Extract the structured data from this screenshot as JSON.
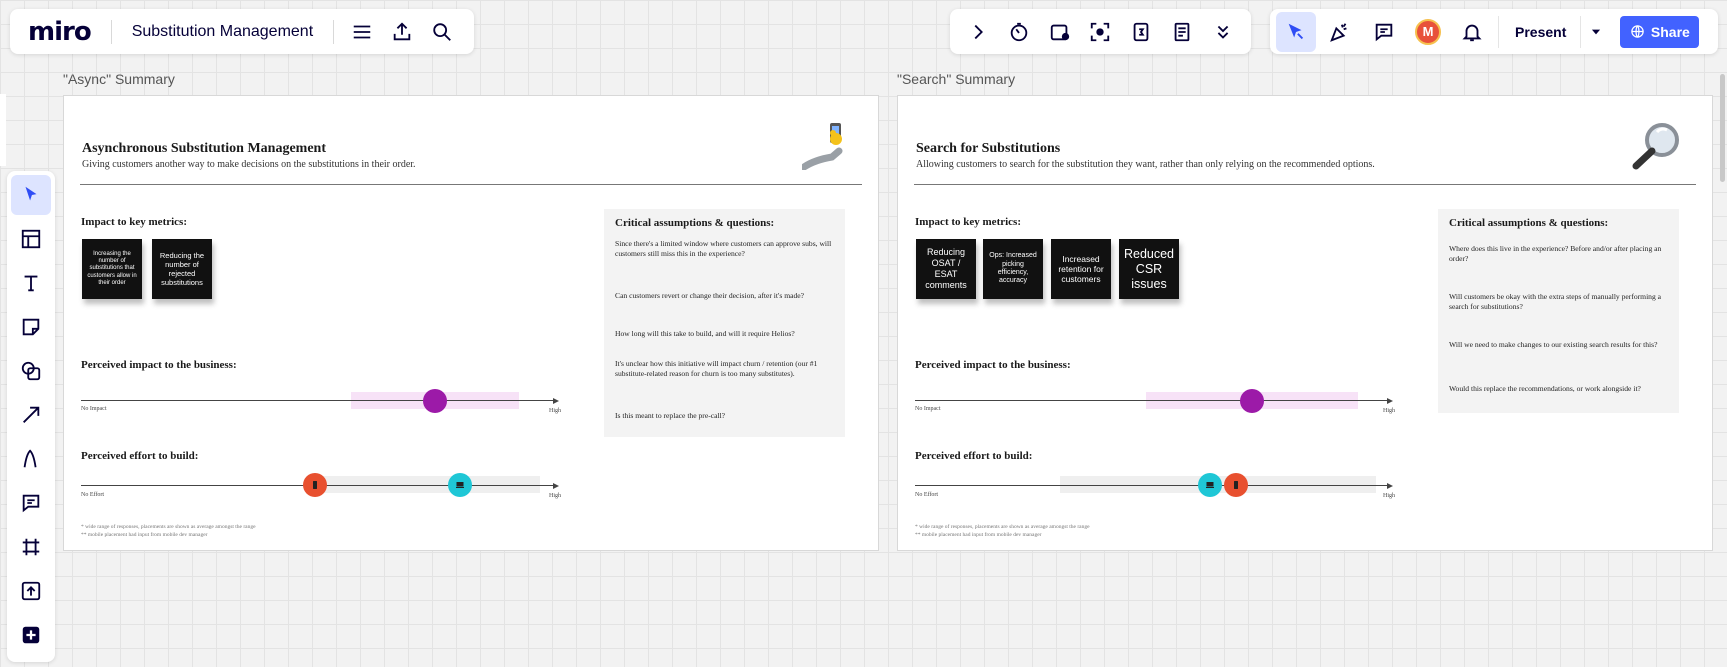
{
  "app": {
    "logo": "miro",
    "board_title": "Substitution Management",
    "present_label": "Present",
    "share_label": "Share",
    "avatar_initial": "M",
    "accent": "#4262ff"
  },
  "top_left_icons": [
    "menu-icon",
    "export-icon",
    "search-icon"
  ],
  "top_right_icons": [
    "chevron-right-icon",
    "timer-icon",
    "voting-icon",
    "focus-icon",
    "calendar-icon",
    "notes-icon",
    "more-chevron-icon"
  ],
  "collab_icons": [
    "cursor-follow-icon",
    "reactions-icon",
    "comments-icon",
    "avatar",
    "bell-icon"
  ],
  "left_toolbar": [
    "select-icon",
    "templates-icon",
    "text-icon",
    "sticky-note-icon",
    "shapes-icon",
    "arrow-icon",
    "pen-icon",
    "comment-icon",
    "frame-icon",
    "upload-icon",
    "add-icon"
  ],
  "frames": [
    {
      "label": "\"Async\" Summary",
      "title": "Asynchronous Substitution Management",
      "subtitle": "Giving customers another way to make decisions on the substitutions in their order.",
      "emoji": "phone-hand",
      "metrics_heading": "Impact to key metrics:",
      "stickies": [
        "Increasing the number of substitutions that customers allow in their order",
        "Reducing the number of rejected substitutions"
      ],
      "business_heading": "Perceived impact to the business:",
      "business_low": "No Impact",
      "business_high": "High",
      "effort_heading": "Perceived effort to build:",
      "effort_low": "No Effort",
      "effort_high": "High",
      "footnote_1": "* wide range of responses, placements are shown as average amongst the range",
      "footnote_2": "** mobile placement had input from mobile dev manager",
      "questions_heading": "Critical assumptions & questions:",
      "questions": [
        "Since there's a limited window where customers can approve subs, will customers still miss this in the experience?",
        "Can customers revert or change their decision, after it's made?",
        "How long will this take to build, and will it require Helios?",
        "It's unclear how this initiative will impact churn / retention (our #1 substitute-related reason for churn is too many substitutes).",
        "Is this meant to replace the pre-call?"
      ]
    },
    {
      "label": "\"Search\" Summary",
      "title": "Search for Substitutions",
      "subtitle": "Allowing customers to search for the substitution they want, rather than only relying on the recommended options.",
      "emoji": "magnifier",
      "metrics_heading": "Impact to key metrics:",
      "stickies": [
        "Reducing OSAT / ESAT comments",
        "Ops: Increased picking efficiency, accuracy",
        "Increased retention for customers",
        "Reduced CSR issues"
      ],
      "business_heading": "Perceived impact to the business:",
      "business_low": "No Impact",
      "business_high": "High",
      "effort_heading": "Perceived effort to build:",
      "effort_low": "No Effort",
      "effort_high": "High",
      "footnote_1": "* wide range of responses, placements are shown as average amongst the range",
      "footnote_2": "** mobile placement had input from mobile dev manager",
      "questions_heading": "Critical assumptions & questions:",
      "questions": [
        "Where does this live in the experience? Before and/or after placing an order?",
        "Will customers be okay with the extra steps of manually performing a search for substitutions?",
        "Will we need to make changes to our existing search results for this?",
        "Would this replace the recommendations, or work alongside it?"
      ]
    }
  ],
  "colors": {
    "impact_dot": "#9c1aa8",
    "impact_band": "#f7e2f7",
    "mobile_dot": "#e8502f",
    "desktop_dot": "#1fc7d6"
  }
}
